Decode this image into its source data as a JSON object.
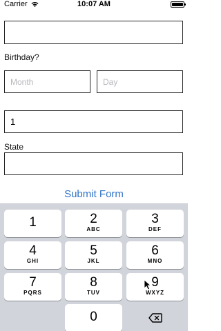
{
  "status_bar": {
    "carrier": "Carrier",
    "time": "10:07 AM"
  },
  "form": {
    "top_field_value": "",
    "birthday_label": "Birthday?",
    "month_placeholder": "Month",
    "day_placeholder": "Day",
    "number_field_value": "1",
    "state_label": "State",
    "state_value": "",
    "submit_label": "Submit Form",
    "accent_color": "#2f73c7"
  },
  "keyboard": {
    "keys": [
      {
        "digit": "1",
        "letters": ""
      },
      {
        "digit": "2",
        "letters": "ABC"
      },
      {
        "digit": "3",
        "letters": "DEF"
      },
      {
        "digit": "4",
        "letters": "GHI"
      },
      {
        "digit": "5",
        "letters": "JKL"
      },
      {
        "digit": "6",
        "letters": "MNO"
      },
      {
        "digit": "7",
        "letters": "PQRS"
      },
      {
        "digit": "8",
        "letters": "TUV"
      },
      {
        "digit": "9",
        "letters": "WXYZ"
      },
      {
        "digit": "0",
        "letters": ""
      }
    ],
    "delete_icon": "backspace-icon"
  }
}
